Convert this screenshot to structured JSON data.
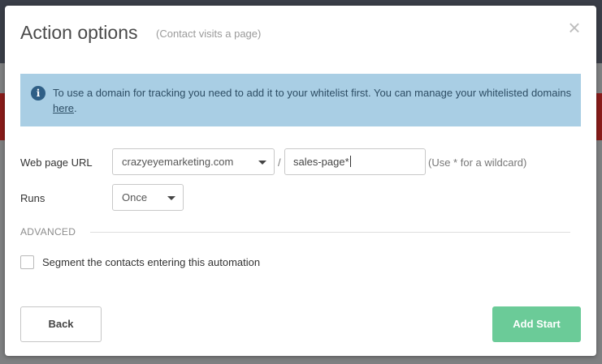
{
  "modal": {
    "title": "Action options",
    "subtitle": "(Contact visits a page)",
    "close_symbol": "×"
  },
  "info": {
    "icon": "info-icon",
    "text": "To use a domain for tracking you need to add it to your whitelist first. You can manage your whitelisted domains ",
    "link_text": "here",
    "after_link": "."
  },
  "form": {
    "url_label": "Web page URL",
    "domain_value": "crazyeyemarketing.com",
    "separator": "/",
    "path_value": "sales-page*",
    "hint": "(Use * for a wildcard)",
    "runs_label": "Runs",
    "runs_value": "Once"
  },
  "advanced": {
    "section_label": "ADVANCED",
    "segment_label": "Segment the contacts entering this automation",
    "segment_checked": false
  },
  "footer": {
    "back_label": "Back",
    "add_label": "Add Start"
  },
  "colors": {
    "info_bg": "#a9cee4",
    "primary_button": "#6bcb98",
    "overlay": "#7f8082"
  }
}
